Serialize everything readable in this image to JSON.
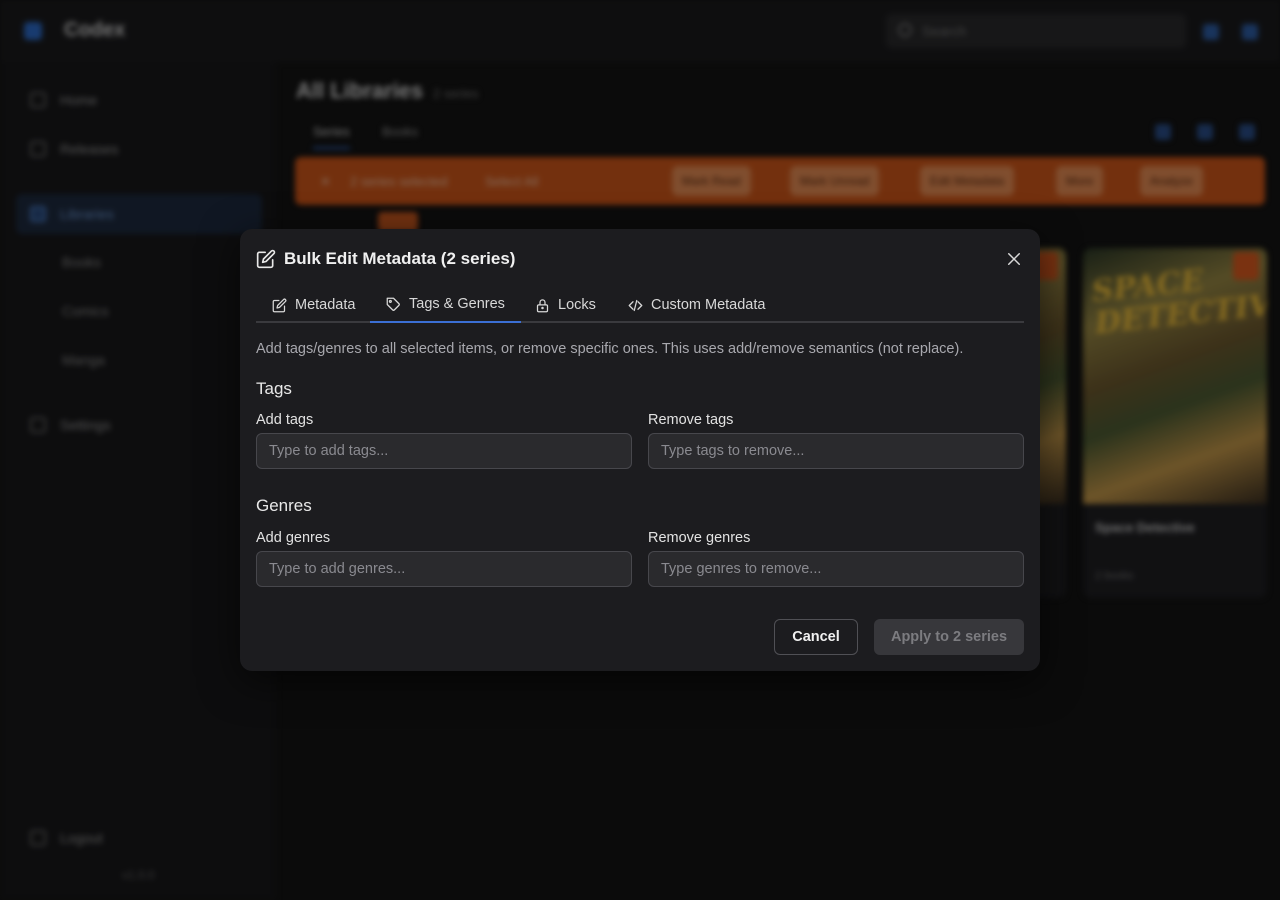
{
  "app": {
    "title": "Codex"
  },
  "header": {
    "search_placeholder": "Search"
  },
  "sidebar": {
    "items": [
      {
        "label": "Home"
      },
      {
        "label": "Releases"
      },
      {
        "label": "Libraries"
      },
      {
        "label": "Settings"
      }
    ],
    "sub_items": [
      {
        "label": "Books"
      },
      {
        "label": "Comics"
      },
      {
        "label": "Manga"
      }
    ],
    "logout": "Logout",
    "version": "v1.0.0"
  },
  "main": {
    "title": "All Libraries",
    "count": "2 series",
    "tabs": [
      {
        "label": "Series"
      },
      {
        "label": "Books"
      }
    ],
    "selection_bar": {
      "selected_text": "2 series selected",
      "select_all": "Select All",
      "buttons": [
        {
          "label": "Mark Read"
        },
        {
          "label": "Mark Unread"
        },
        {
          "label": "Edit Metadata"
        },
        {
          "label": "More"
        },
        {
          "label": "Analyze"
        }
      ]
    },
    "card": {
      "cover_title": "SPACE DETECTIVE",
      "name": "Space Detective",
      "meta": "2 books"
    }
  },
  "modal": {
    "title": "Bulk Edit Metadata (2 series)",
    "tabs": [
      {
        "label": "Metadata",
        "icon": "edit-icon"
      },
      {
        "label": "Tags & Genres",
        "icon": "tag-icon"
      },
      {
        "label": "Locks",
        "icon": "lock-icon"
      },
      {
        "label": "Custom Metadata",
        "icon": "code-icon"
      }
    ],
    "active_tab": "Tags & Genres",
    "description": "Add tags/genres to all selected items, or remove specific ones. This uses add/remove semantics (not replace).",
    "tags": {
      "title": "Tags",
      "add_label": "Add tags",
      "add_placeholder": "Type to add tags...",
      "remove_label": "Remove tags",
      "remove_placeholder": "Type tags to remove..."
    },
    "genres": {
      "title": "Genres",
      "add_label": "Add genres",
      "add_placeholder": "Type to add genres...",
      "remove_label": "Remove genres",
      "remove_placeholder": "Type genres to remove..."
    },
    "cancel_label": "Cancel",
    "apply_label": "Apply to 2 series"
  },
  "colors": {
    "accent": "#3b6fd4",
    "selection_bar": "#d2581a",
    "modal_bg": "#1c1c1f"
  }
}
